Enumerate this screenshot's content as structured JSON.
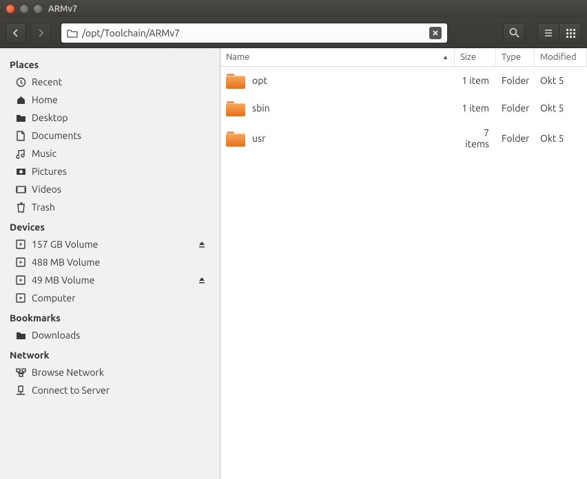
{
  "window": {
    "title": "ARMv7"
  },
  "toolbar": {
    "path": "/opt/Toolchain/ARMv7"
  },
  "sidebar": {
    "places_title": "Places",
    "places": [
      {
        "label": "Recent",
        "icon": "clock"
      },
      {
        "label": "Home",
        "icon": "home"
      },
      {
        "label": "Desktop",
        "icon": "folder"
      },
      {
        "label": "Documents",
        "icon": "document"
      },
      {
        "label": "Music",
        "icon": "music"
      },
      {
        "label": "Pictures",
        "icon": "camera"
      },
      {
        "label": "Videos",
        "icon": "video"
      },
      {
        "label": "Trash",
        "icon": "trash"
      }
    ],
    "devices_title": "Devices",
    "devices": [
      {
        "label": "157 GB Volume",
        "icon": "disk",
        "eject": true
      },
      {
        "label": "488 MB Volume",
        "icon": "disk",
        "eject": false
      },
      {
        "label": "49 MB Volume",
        "icon": "disk",
        "eject": true
      },
      {
        "label": "Computer",
        "icon": "disk",
        "eject": false
      }
    ],
    "bookmarks_title": "Bookmarks",
    "bookmarks": [
      {
        "label": "Downloads",
        "icon": "folder"
      }
    ],
    "network_title": "Network",
    "network": [
      {
        "label": "Browse Network",
        "icon": "network"
      },
      {
        "label": "Connect to Server",
        "icon": "server"
      }
    ]
  },
  "columns": {
    "name": "Name",
    "size": "Size",
    "type": "Type",
    "modified": "Modified"
  },
  "files": [
    {
      "name": "opt",
      "size": "1 item",
      "type": "Folder",
      "modified": "Okt 5"
    },
    {
      "name": "sbin",
      "size": "1 item",
      "type": "Folder",
      "modified": "Okt 5"
    },
    {
      "name": "usr",
      "size": "7 items",
      "type": "Folder",
      "modified": "Okt 5"
    }
  ]
}
